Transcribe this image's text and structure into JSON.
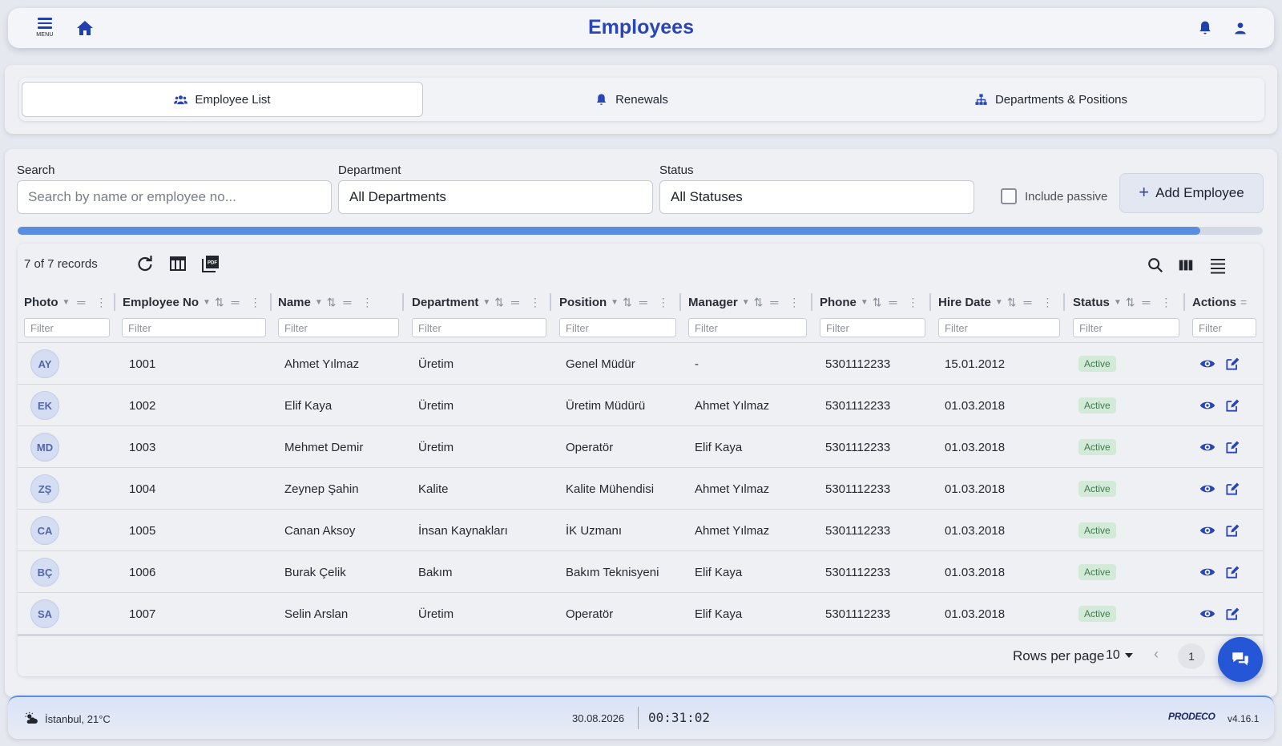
{
  "header": {
    "menu_label": "MENU",
    "title": "Employees",
    "icons": [
      "menu-icon",
      "home-icon",
      "bell-icon",
      "user-icon"
    ]
  },
  "tabs": [
    {
      "label": "Employee List",
      "icon": "users-icon",
      "active": true
    },
    {
      "label": "Renewals",
      "icon": "bell-icon",
      "active": false
    },
    {
      "label": "Departments & Positions",
      "icon": "org-chart-icon",
      "active": false
    }
  ],
  "filters": {
    "search_label": "Search",
    "search_placeholder": "Search by name or employee no...",
    "department_label": "Department",
    "department_value": "All Departments",
    "status_label": "Status",
    "status_value": "All Statuses",
    "include_passive_label": "Include passive",
    "include_passive_checked": false,
    "add_button_label": "Add Employee"
  },
  "progress_fraction": 0.95,
  "grid": {
    "record_count": "7 of 7 records",
    "filter_placeholder": "Filter",
    "columns": [
      "Photo",
      "Employee No",
      "Name",
      "Department",
      "Position",
      "Manager",
      "Phone",
      "Hire Date",
      "Status",
      "Actions"
    ],
    "rows": [
      {
        "initials": "AY",
        "no": "1001",
        "name": "Ahmet Yılmaz",
        "department": "Üretim",
        "position": "Genel Müdür",
        "manager": "-",
        "phone": "5301112233",
        "hire_date": "15.01.2012",
        "status": "Active"
      },
      {
        "initials": "EK",
        "no": "1002",
        "name": "Elif Kaya",
        "department": "Üretim",
        "position": "Üretim Müdürü",
        "manager": "Ahmet Yılmaz",
        "phone": "5301112233",
        "hire_date": "01.03.2018",
        "status": "Active"
      },
      {
        "initials": "MD",
        "no": "1003",
        "name": "Mehmet Demir",
        "department": "Üretim",
        "position": "Operatör",
        "manager": "Elif Kaya",
        "phone": "5301112233",
        "hire_date": "01.03.2018",
        "status": "Active"
      },
      {
        "initials": "ZŞ",
        "no": "1004",
        "name": "Zeynep Şahin",
        "department": "Kalite",
        "position": "Kalite Mühendisi",
        "manager": "Ahmet Yılmaz",
        "phone": "5301112233",
        "hire_date": "01.03.2018",
        "status": "Active"
      },
      {
        "initials": "CA",
        "no": "1005",
        "name": "Canan Aksoy",
        "department": "İnsan Kaynakları",
        "position": "İK Uzmanı",
        "manager": "Ahmet Yılmaz",
        "phone": "5301112233",
        "hire_date": "01.03.2018",
        "status": "Active"
      },
      {
        "initials": "BÇ",
        "no": "1006",
        "name": "Burak Çelik",
        "department": "Bakım",
        "position": "Bakım Teknisyeni",
        "manager": "Elif Kaya",
        "phone": "5301112233",
        "hire_date": "01.03.2018",
        "status": "Active"
      },
      {
        "initials": "SA",
        "no": "1007",
        "name": "Selin Arslan",
        "department": "Üretim",
        "position": "Operatör",
        "manager": "Elif Kaya",
        "phone": "5301112233",
        "hire_date": "01.03.2018",
        "status": "Active"
      }
    ],
    "rows_per_page_label": "Rows per page",
    "rows_per_page_value": "10",
    "current_page": "1"
  },
  "statusbar": {
    "weather": "İstanbul, 21°C",
    "date": "30.08.2026",
    "clock": "00:31:02",
    "brand": "PRODECO",
    "version": "v4.16.1"
  },
  "colors": {
    "accent": "#2a46b6",
    "progress": "#5a8ddf",
    "active_badge_bg": "#d4ead9",
    "active_badge_text": "#3e7a4e",
    "avatar_bg": "#d5ddf2",
    "chat_fab": "#2456d6"
  }
}
